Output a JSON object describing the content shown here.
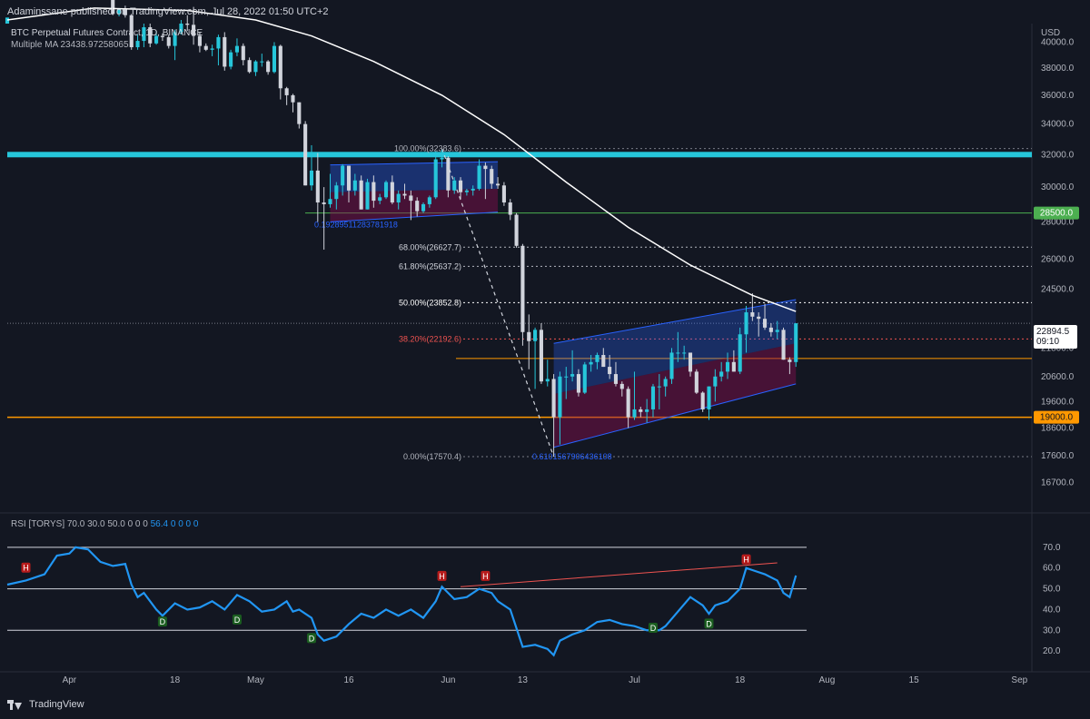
{
  "header": {
    "published_text": "Adaminssane published on TradingView.com, Jul 28, 2022 01:50 UTC+2"
  },
  "legend": {
    "symbol_line": "BTC Perpetual Futures Contract, 1D, BINANCE",
    "indicator_line": "Multiple MA 23438.97258065"
  },
  "price_axis": {
    "currency": "USD",
    "ticks": [
      "40000.0",
      "38000.0",
      "36000.0",
      "34000.0",
      "32000.0",
      "30000.0",
      "28000.0",
      "26000.0",
      "24500.0",
      "21800.0",
      "20600.0",
      "19600.0",
      "18600.0",
      "17600.0",
      "16700.0"
    ],
    "tagged_levels": [
      {
        "label": "28500.0",
        "color": "#4caf50"
      },
      {
        "label": "19000.0",
        "color": "#ff9800"
      }
    ],
    "current_price": "22894.5",
    "countdown": "09:10"
  },
  "fib_labels": [
    {
      "text": "100.00%(32383.6)",
      "color": "#b2b5be"
    },
    {
      "text": "68.00%(26627.7)",
      "color": "#d1d4dc"
    },
    {
      "text": "61.80%(25637.2)",
      "color": "#d1d4dc"
    },
    {
      "text": "50.00%(23852.8)",
      "color": "#ffffff"
    },
    {
      "text": "38.20%(22192.6)",
      "color": "#ef5350"
    },
    {
      "text": "0.00%(17570.4)",
      "color": "#b2b5be"
    }
  ],
  "channel_labels": [
    {
      "text": "0.19289511283781918"
    },
    {
      "text": "0.6101567906436108"
    }
  ],
  "rsi": {
    "legend_text": "RSI [TORYS] 70.0 30.0 50.0 0 0 0",
    "legend_value": "56.4 0 0 0 0",
    "ticks": [
      "70.0",
      "60.0",
      "50.0",
      "40.0",
      "30.0",
      "20.0"
    ],
    "markers_h": [
      "H",
      "H",
      "H",
      "H"
    ],
    "markers_d": [
      "D",
      "D",
      "D",
      "D",
      "D"
    ]
  },
  "time_axis": {
    "labels": [
      "Apr",
      "18",
      "May",
      "16",
      "Jun",
      "13",
      "Jul",
      "18",
      "Aug",
      "15",
      "Sep"
    ]
  },
  "colors": {
    "background": "#131722",
    "bull": "#26c6da",
    "bear": "#d1d4dc",
    "resistance": "#26c6da",
    "support_orange": "#ff9800",
    "green_level": "#4caf50",
    "ma": "#ffffff",
    "channel": "#2962ff",
    "rsi_line": "#2196f3"
  },
  "chart_data": {
    "type": "candlestick",
    "y_scale": "log",
    "ylim": [
      15800,
      41500
    ],
    "x_range": [
      "2022-03-22",
      "2022-09-03"
    ],
    "candles": [
      [
        "2022-03-22",
        41500,
        42000,
        41800,
        42000
      ],
      [
        "2022-03-25",
        44300,
        44900,
        44100,
        44500
      ],
      [
        "2022-04-05",
        46600,
        47200,
        45200,
        45500
      ],
      [
        "2022-04-08",
        43500,
        43900,
        42200,
        42300
      ],
      [
        "2022-04-09",
        42300,
        42800,
        42100,
        42700
      ],
      [
        "2022-04-10",
        42700,
        43000,
        42000,
        42200
      ],
      [
        "2022-04-11",
        42200,
        42300,
        39400,
        39600
      ],
      [
        "2022-04-12",
        39600,
        40600,
        39400,
        40100
      ],
      [
        "2022-04-13",
        40100,
        41500,
        39600,
        41200
      ],
      [
        "2022-04-14",
        41200,
        41500,
        39600,
        39900
      ],
      [
        "2022-04-15",
        39900,
        40900,
        39800,
        40500
      ],
      [
        "2022-04-16",
        40500,
        40700,
        40100,
        40400
      ],
      [
        "2022-04-17",
        40400,
        40600,
        39500,
        39700
      ],
      [
        "2022-04-18",
        39700,
        41000,
        38600,
        40800
      ],
      [
        "2022-04-19",
        40800,
        41800,
        40600,
        41500
      ],
      [
        "2022-04-20",
        41500,
        42200,
        40900,
        41400
      ],
      [
        "2022-04-21",
        41400,
        42900,
        39800,
        40500
      ],
      [
        "2022-04-22",
        40500,
        40800,
        39200,
        39700
      ],
      [
        "2022-04-23",
        39700,
        39900,
        39300,
        39400
      ],
      [
        "2022-04-24",
        39400,
        39800,
        38900,
        39500
      ],
      [
        "2022-04-25",
        39500,
        40600,
        38200,
        40400
      ],
      [
        "2022-04-26",
        40400,
        40800,
        37800,
        38100
      ],
      [
        "2022-04-27",
        38100,
        39400,
        37900,
        39200
      ],
      [
        "2022-04-28",
        39200,
        40300,
        38900,
        39700
      ],
      [
        "2022-04-29",
        39700,
        39900,
        38200,
        38600
      ],
      [
        "2022-04-30",
        38600,
        38800,
        37600,
        37700
      ],
      [
        "2022-05-01",
        37700,
        38600,
        37400,
        38500
      ],
      [
        "2022-05-02",
        38500,
        39100,
        38100,
        38500
      ],
      [
        "2022-05-03",
        38500,
        38600,
        37500,
        37700
      ],
      [
        "2022-05-04",
        37700,
        40000,
        37600,
        39700
      ],
      [
        "2022-05-05",
        39700,
        39800,
        35700,
        36500
      ],
      [
        "2022-05-06",
        36500,
        36600,
        35300,
        36000
      ],
      [
        "2022-05-07",
        36000,
        36100,
        34800,
        35500
      ],
      [
        "2022-05-08",
        35500,
        35500,
        33700,
        34000
      ],
      [
        "2022-05-09",
        34000,
        34200,
        30100,
        30100
      ],
      [
        "2022-05-10",
        30100,
        32600,
        29800,
        31000
      ],
      [
        "2022-05-11",
        31000,
        32100,
        28000,
        29100
      ],
      [
        "2022-05-12",
        29100,
        30000,
        26500,
        29000
      ],
      [
        "2022-05-13",
        29000,
        30800,
        28800,
        29300
      ],
      [
        "2022-05-14",
        29300,
        30300,
        28700,
        30100
      ],
      [
        "2022-05-15",
        30100,
        31400,
        29500,
        31300
      ],
      [
        "2022-05-16",
        31300,
        31300,
        29100,
        29800
      ],
      [
        "2022-05-17",
        29800,
        30800,
        29500,
        30400
      ],
      [
        "2022-05-18",
        30400,
        30700,
        28700,
        28700
      ],
      [
        "2022-05-19",
        28700,
        30500,
        28700,
        30300
      ],
      [
        "2022-05-20",
        30300,
        30700,
        28800,
        29200
      ],
      [
        "2022-05-21",
        29200,
        29600,
        29000,
        29400
      ],
      [
        "2022-05-22",
        29400,
        30400,
        29300,
        30300
      ],
      [
        "2022-05-23",
        30300,
        30700,
        29000,
        29100
      ],
      [
        "2022-05-24",
        29100,
        29800,
        28700,
        29600
      ],
      [
        "2022-05-25",
        29600,
        30200,
        29300,
        29500
      ],
      [
        "2022-05-26",
        29500,
        29800,
        28100,
        29200
      ],
      [
        "2022-05-27",
        29200,
        29400,
        28300,
        28600
      ],
      [
        "2022-05-28",
        28600,
        29100,
        28500,
        29000
      ],
      [
        "2022-05-29",
        29000,
        29500,
        28800,
        29400
      ],
      [
        "2022-05-30",
        29400,
        32200,
        29300,
        31700
      ],
      [
        "2022-05-31",
        31700,
        32300,
        31200,
        31800
      ],
      [
        "2022-06-01",
        31800,
        31900,
        29400,
        29800
      ],
      [
        "2022-06-02",
        29800,
        30600,
        29600,
        30400
      ],
      [
        "2022-06-03",
        30400,
        30600,
        29300,
        29700
      ],
      [
        "2022-06-04",
        29700,
        29900,
        29500,
        29800
      ],
      [
        "2022-06-05",
        29800,
        30100,
        29500,
        29900
      ],
      [
        "2022-06-06",
        29900,
        31700,
        29800,
        31300
      ],
      [
        "2022-06-07",
        31300,
        31500,
        29300,
        31100
      ],
      [
        "2022-06-08",
        31100,
        31300,
        29900,
        30200
      ],
      [
        "2022-06-09",
        30200,
        30600,
        29900,
        30100
      ],
      [
        "2022-06-10",
        30100,
        30300,
        28900,
        29100
      ],
      [
        "2022-06-11",
        29100,
        29300,
        28100,
        28400
      ],
      [
        "2022-06-12",
        28400,
        28500,
        26600,
        26700
      ],
      [
        "2022-06-13",
        26700,
        26800,
        21900,
        22500
      ],
      [
        "2022-06-14",
        22500,
        23300,
        20900,
        22100
      ],
      [
        "2022-06-15",
        22100,
        22700,
        20100,
        22600
      ],
      [
        "2022-06-16",
        22600,
        22900,
        20300,
        20400
      ],
      [
        "2022-06-17",
        20400,
        21300,
        20200,
        20500
      ],
      [
        "2022-06-18",
        20500,
        20700,
        17600,
        19000
      ],
      [
        "2022-06-19",
        19000,
        20800,
        18000,
        20600
      ],
      [
        "2022-06-20",
        20600,
        21000,
        19700,
        20600
      ],
      [
        "2022-06-21",
        20600,
        21700,
        20400,
        20700
      ],
      [
        "2022-06-22",
        20700,
        20900,
        19800,
        19950
      ],
      [
        "2022-06-23",
        19950,
        21200,
        19900,
        21100
      ],
      [
        "2022-06-24",
        21100,
        21500,
        20800,
        21200
      ],
      [
        "2022-06-25",
        21200,
        21600,
        20900,
        21500
      ],
      [
        "2022-06-26",
        21500,
        21800,
        21000,
        21000
      ],
      [
        "2022-06-27",
        21000,
        21500,
        20500,
        20700
      ],
      [
        "2022-06-28",
        20700,
        21200,
        20200,
        20300
      ],
      [
        "2022-06-29",
        20300,
        20400,
        19800,
        20100
      ],
      [
        "2022-06-30",
        20100,
        20200,
        18600,
        19000
      ],
      [
        "2022-07-01",
        19000,
        20800,
        18900,
        19300
      ],
      [
        "2022-07-02",
        19300,
        19400,
        19000,
        19200
      ],
      [
        "2022-07-03",
        19200,
        19700,
        18800,
        19300
      ],
      [
        "2022-07-04",
        19300,
        20300,
        19000,
        20200
      ],
      [
        "2022-07-05",
        20200,
        20700,
        19300,
        20200
      ],
      [
        "2022-07-06",
        20200,
        20600,
        19800,
        20500
      ],
      [
        "2022-07-07",
        20500,
        21800,
        20300,
        21600
      ],
      [
        "2022-07-08",
        21600,
        22500,
        21200,
        21600
      ],
      [
        "2022-07-09",
        21600,
        21900,
        21300,
        21600
      ],
      [
        "2022-07-10",
        21600,
        21600,
        20600,
        20800
      ],
      [
        "2022-07-11",
        20800,
        20900,
        19900,
        19950
      ],
      [
        "2022-07-12",
        19950,
        20000,
        19200,
        19300
      ],
      [
        "2022-07-13",
        19300,
        20200,
        18900,
        20200
      ],
      [
        "2022-07-14",
        20200,
        20900,
        19600,
        20600
      ],
      [
        "2022-07-15",
        20600,
        21200,
        20400,
        20800
      ],
      [
        "2022-07-16",
        20800,
        21600,
        20500,
        21200
      ],
      [
        "2022-07-17",
        21200,
        21700,
        20800,
        20800
      ],
      [
        "2022-07-18",
        20800,
        22700,
        20700,
        22400
      ],
      [
        "2022-07-19",
        22400,
        23700,
        21600,
        23400
      ],
      [
        "2022-07-20",
        23400,
        24300,
        23000,
        23200
      ],
      [
        "2022-07-21",
        23200,
        23400,
        22300,
        23100
      ],
      [
        "2022-07-22",
        23100,
        23800,
        22600,
        22700
      ],
      [
        "2022-07-23",
        22700,
        22900,
        22300,
        22500
      ],
      [
        "2022-07-24",
        22500,
        23000,
        22200,
        22600
      ],
      [
        "2022-07-25",
        22600,
        22700,
        21300,
        21300
      ],
      [
        "2022-07-26",
        21300,
        21400,
        20700,
        21200
      ],
      [
        "2022-07-27",
        21200,
        22900,
        21000,
        22894.5
      ]
    ],
    "ma": [
      [
        "2022-03-22",
        41800
      ],
      [
        "2022-04-05",
        42800
      ],
      [
        "2022-04-20",
        42600
      ],
      [
        "2022-05-01",
        41800
      ],
      [
        "2022-05-10",
        40500
      ],
      [
        "2022-05-20",
        38500
      ],
      [
        "2022-05-31",
        36000
      ],
      [
        "2022-06-10",
        33300
      ],
      [
        "2022-06-20",
        30300
      ],
      [
        "2022-06-30",
        27700
      ],
      [
        "2022-07-10",
        25700
      ],
      [
        "2022-07-20",
        24200
      ],
      [
        "2022-07-27",
        23440
      ]
    ],
    "rsi": [
      [
        "2022-03-22",
        52
      ],
      [
        "2022-03-25",
        54
      ],
      [
        "2022-03-28",
        57
      ],
      [
        "2022-03-30",
        66
      ],
      [
        "2022-04-01",
        67
      ],
      [
        "2022-04-02",
        70
      ],
      [
        "2022-04-04",
        69
      ],
      [
        "2022-04-06",
        63
      ],
      [
        "2022-04-08",
        61
      ],
      [
        "2022-04-10",
        62
      ],
      [
        "2022-04-11",
        52
      ],
      [
        "2022-04-12",
        46
      ],
      [
        "2022-04-13",
        48
      ],
      [
        "2022-04-15",
        40
      ],
      [
        "2022-04-16",
        37
      ],
      [
        "2022-04-18",
        43
      ],
      [
        "2022-04-20",
        40
      ],
      [
        "2022-04-22",
        41
      ],
      [
        "2022-04-24",
        44
      ],
      [
        "2022-04-26",
        40
      ],
      [
        "2022-04-28",
        47
      ],
      [
        "2022-04-30",
        44
      ],
      [
        "2022-05-02",
        39
      ],
      [
        "2022-05-04",
        40
      ],
      [
        "2022-05-06",
        44
      ],
      [
        "2022-05-07",
        39
      ],
      [
        "2022-05-08",
        40
      ],
      [
        "2022-05-10",
        36
      ],
      [
        "2022-05-11",
        28
      ],
      [
        "2022-05-12",
        25
      ],
      [
        "2022-05-14",
        27
      ],
      [
        "2022-05-16",
        33
      ],
      [
        "2022-05-18",
        38
      ],
      [
        "2022-05-20",
        36
      ],
      [
        "2022-05-22",
        40
      ],
      [
        "2022-05-24",
        37
      ],
      [
        "2022-05-26",
        40
      ],
      [
        "2022-05-28",
        36
      ],
      [
        "2022-05-30",
        44
      ],
      [
        "2022-05-31",
        51
      ],
      [
        "2022-06-02",
        45
      ],
      [
        "2022-06-04",
        46
      ],
      [
        "2022-06-06",
        50
      ],
      [
        "2022-06-08",
        48
      ],
      [
        "2022-06-09",
        44
      ],
      [
        "2022-06-11",
        40
      ],
      [
        "2022-06-12",
        31
      ],
      [
        "2022-06-13",
        22
      ],
      [
        "2022-06-15",
        23
      ],
      [
        "2022-06-17",
        21
      ],
      [
        "2022-06-18",
        18
      ],
      [
        "2022-06-19",
        25
      ],
      [
        "2022-06-21",
        28
      ],
      [
        "2022-06-23",
        30
      ],
      [
        "2022-06-25",
        34
      ],
      [
        "2022-06-27",
        35
      ],
      [
        "2022-06-29",
        33
      ],
      [
        "2022-07-01",
        32
      ],
      [
        "2022-07-03",
        30
      ],
      [
        "2022-07-05",
        30
      ],
      [
        "2022-07-06",
        32
      ],
      [
        "2022-07-08",
        39
      ],
      [
        "2022-07-10",
        46
      ],
      [
        "2022-07-12",
        42
      ],
      [
        "2022-07-13",
        38
      ],
      [
        "2022-07-14",
        42
      ],
      [
        "2022-07-16",
        44
      ],
      [
        "2022-07-18",
        50
      ],
      [
        "2022-07-19",
        60
      ],
      [
        "2022-07-20",
        59
      ],
      [
        "2022-07-22",
        57
      ],
      [
        "2022-07-24",
        54
      ],
      [
        "2022-07-25",
        48
      ],
      [
        "2022-07-26",
        46
      ],
      [
        "2022-07-27",
        56.4
      ]
    ],
    "levels": {
      "resistance_band": 32000,
      "green_line": 28500,
      "orange_support": 19000,
      "orange_mid": 21350,
      "fib_100": 32383.6,
      "fib_68": 26627.7,
      "fib_618": 25637.2,
      "fib_50": 23852.8,
      "fib_382": 22192.6,
      "fib_0": 17570.4
    },
    "rsi_levels": [
      70,
      50,
      30
    ]
  }
}
